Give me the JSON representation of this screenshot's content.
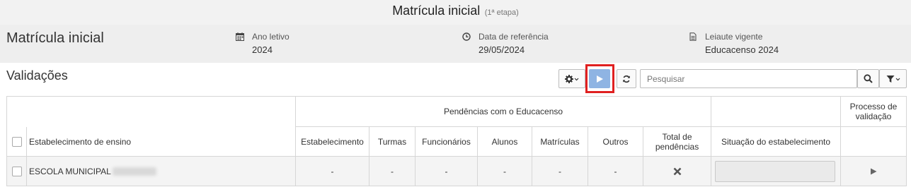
{
  "header": {
    "title": "Matrícula inicial",
    "subtitle": "(1ª etapa)"
  },
  "info": {
    "page_title": "Matrícula inicial",
    "ano_label": "Ano letivo",
    "ano_value": "2024",
    "data_label": "Data de referência",
    "data_value": "29/05/2024",
    "leiaute_label": "Leiaute vigente",
    "leiaute_value": "Educacenso 2024"
  },
  "validacoes": {
    "title": "Validações",
    "search_placeholder": "Pesquisar"
  },
  "table": {
    "group_header": "Pendências com o Educacenso",
    "processo_header": "Processo de validação",
    "columns": {
      "estabelecimento_ensino": "Estabelecimento de ensino",
      "estabelecimento": "Estabelecimento",
      "turmas": "Turmas",
      "funcionarios": "Funcionários",
      "alunos": "Alunos",
      "matriculas": "Matrículas",
      "outros": "Outros",
      "total": "Total de pendências",
      "situacao": "Situação do estabelecimento"
    },
    "rows": [
      {
        "escola": "ESCOLA MUNICIPAL",
        "estabelecimento": "-",
        "turmas": "-",
        "funcionarios": "-",
        "alunos": "-",
        "matriculas": "-",
        "outros": "-"
      }
    ]
  },
  "colors": {
    "accent": "#8fb4e3",
    "highlight": "#e02020"
  }
}
